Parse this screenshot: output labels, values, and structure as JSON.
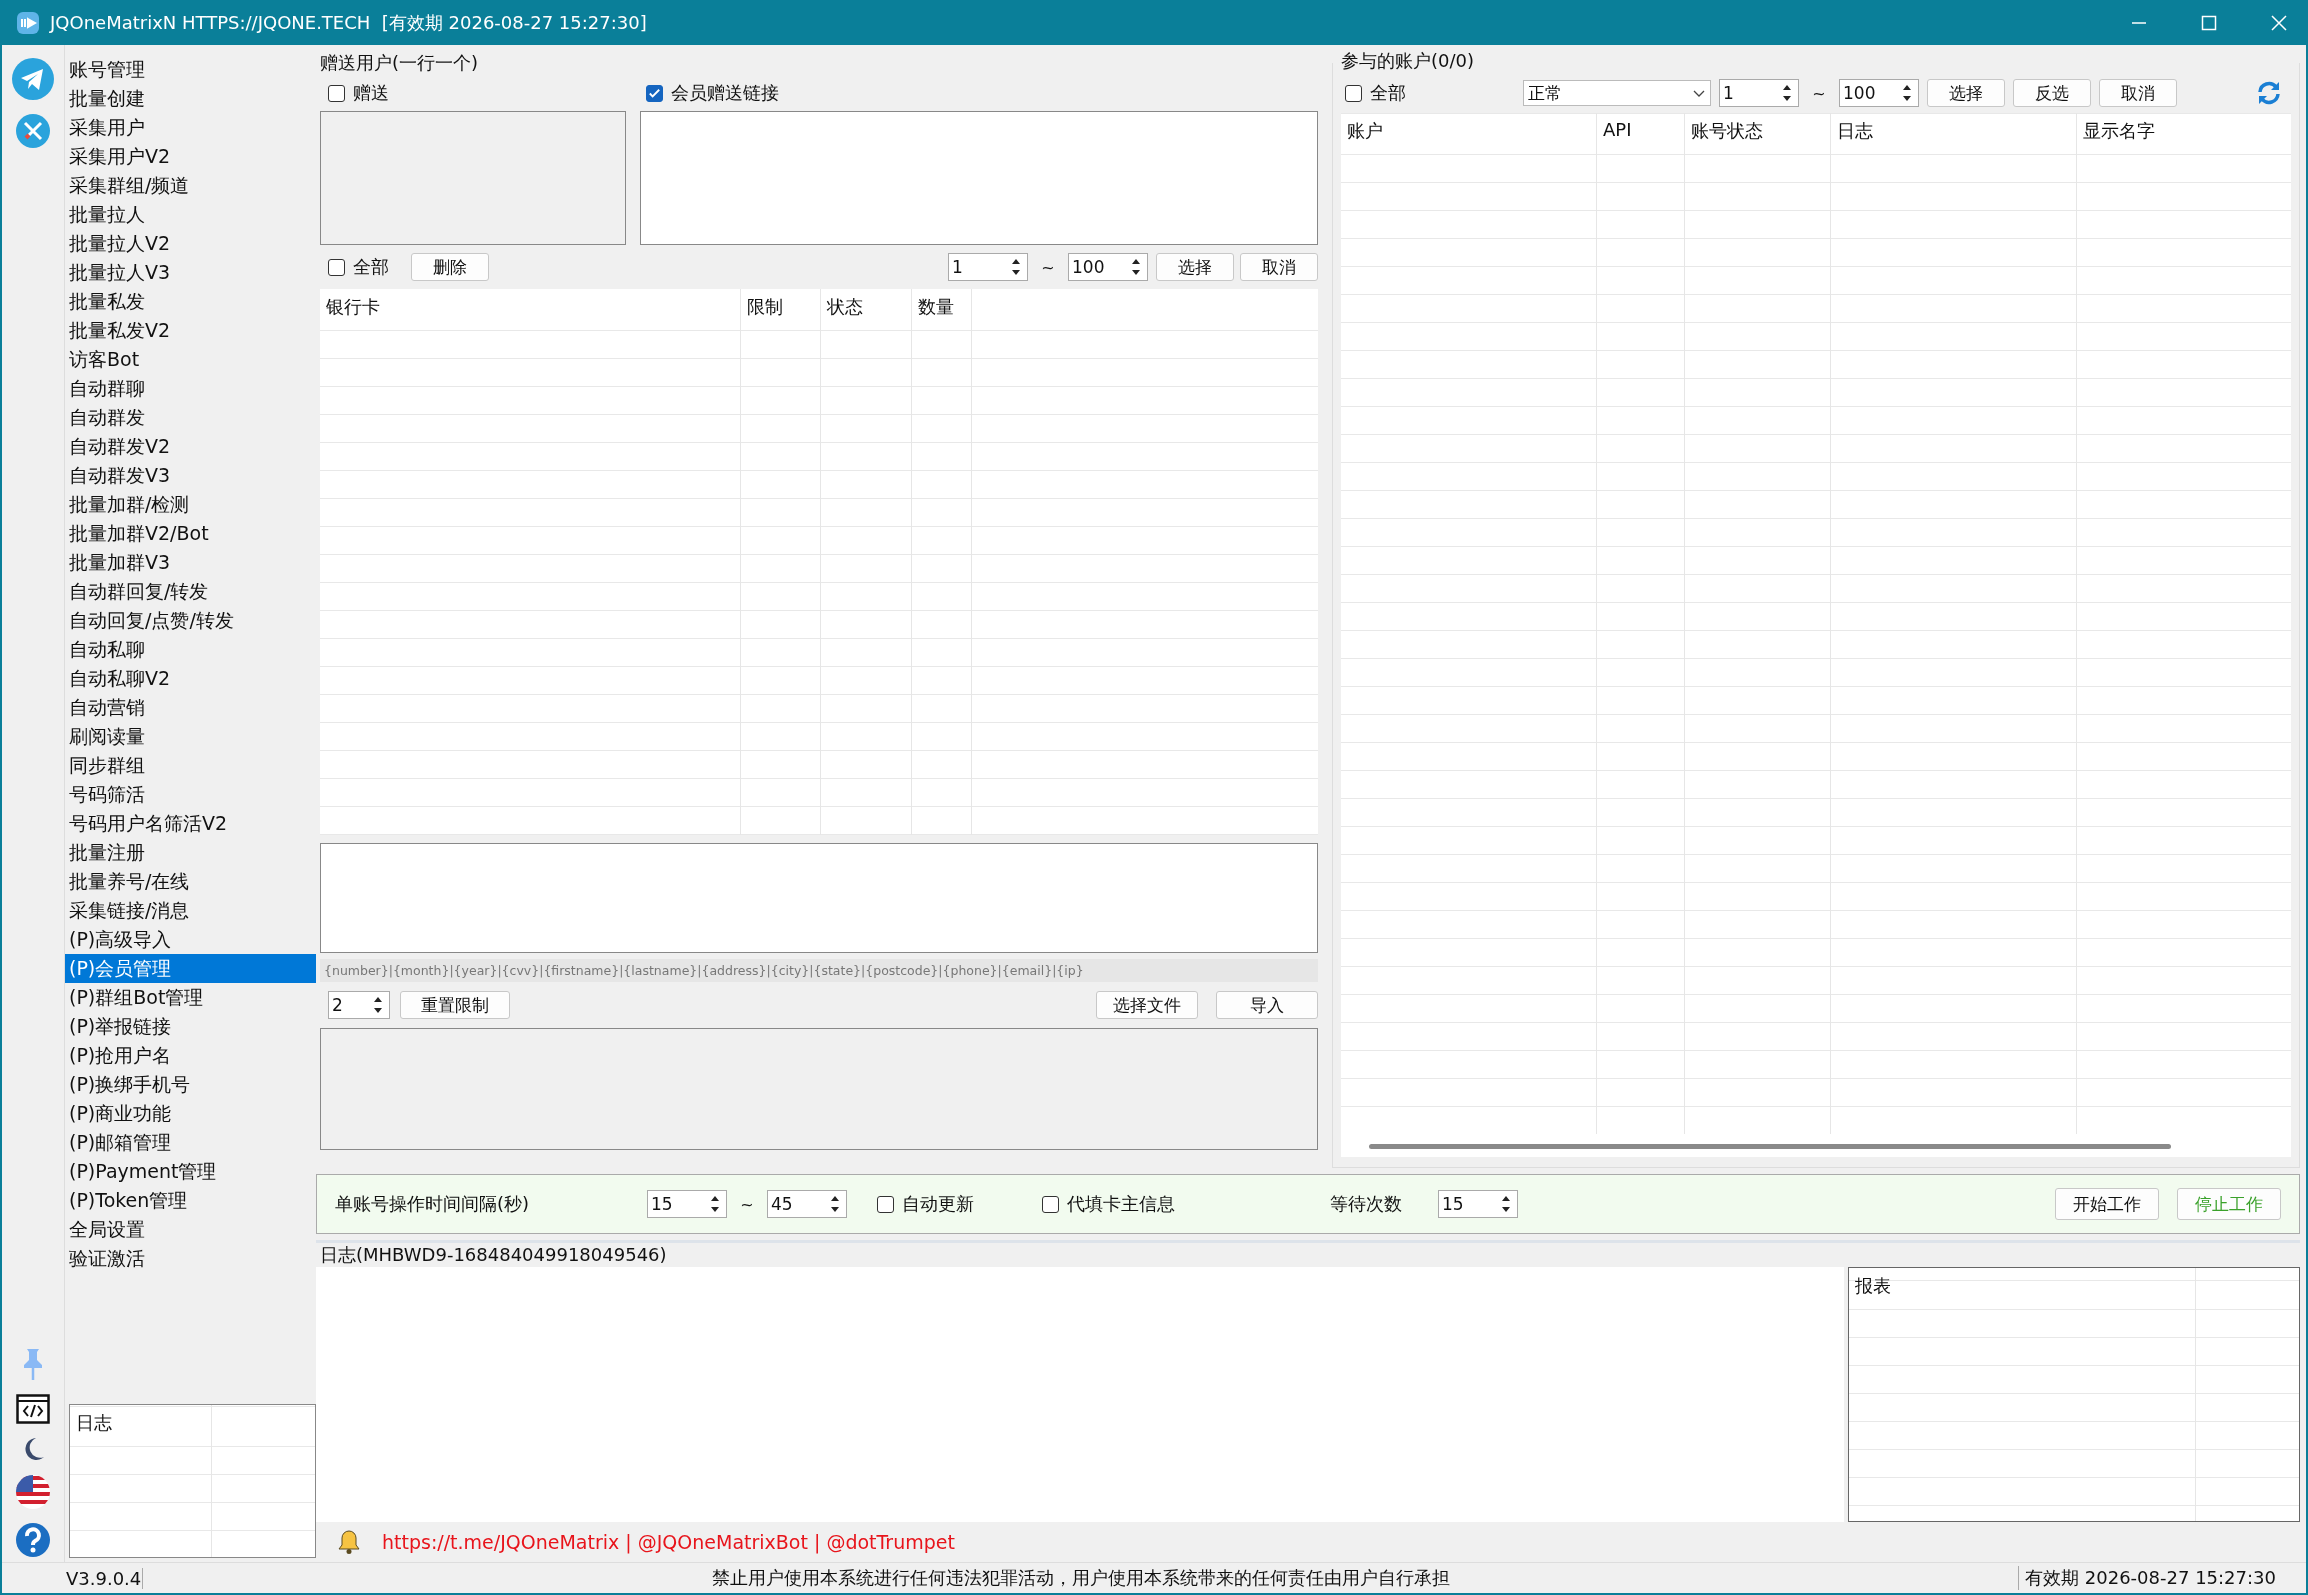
{
  "window": {
    "title": "JQOneMatrixN HTTPS://JQONE.TECH  [有效期 2026-08-27 15:27:30]"
  },
  "sidebar": {
    "items": [
      {
        "label": "账号管理",
        "selected": false
      },
      {
        "label": "批量创建",
        "selected": false
      },
      {
        "label": "采集用户",
        "selected": false
      },
      {
        "label": "采集用户V2",
        "selected": false
      },
      {
        "label": "采集群组/频道",
        "selected": false
      },
      {
        "label": "批量拉人",
        "selected": false
      },
      {
        "label": "批量拉人V2",
        "selected": false
      },
      {
        "label": "批量拉人V3",
        "selected": false
      },
      {
        "label": "批量私发",
        "selected": false
      },
      {
        "label": "批量私发V2",
        "selected": false
      },
      {
        "label": "访客Bot",
        "selected": false
      },
      {
        "label": "自动群聊",
        "selected": false
      },
      {
        "label": "自动群发",
        "selected": false
      },
      {
        "label": "自动群发V2",
        "selected": false
      },
      {
        "label": "自动群发V3",
        "selected": false
      },
      {
        "label": "批量加群/检测",
        "selected": false
      },
      {
        "label": "批量加群V2/Bot",
        "selected": false
      },
      {
        "label": "批量加群V3",
        "selected": false
      },
      {
        "label": "自动群回复/转发",
        "selected": false
      },
      {
        "label": "自动回复/点赞/转发",
        "selected": false
      },
      {
        "label": "自动私聊",
        "selected": false
      },
      {
        "label": "自动私聊V2",
        "selected": false
      },
      {
        "label": "自动营销",
        "selected": false
      },
      {
        "label": "刷阅读量",
        "selected": false
      },
      {
        "label": "同步群组",
        "selected": false
      },
      {
        "label": "号码筛活",
        "selected": false
      },
      {
        "label": "号码用户名筛活V2",
        "selected": false
      },
      {
        "label": "批量注册",
        "selected": false
      },
      {
        "label": "批量养号/在线",
        "selected": false
      },
      {
        "label": "采集链接/消息",
        "selected": false
      },
      {
        "label": "(P)高级导入",
        "selected": false
      },
      {
        "label": "(P)会员管理",
        "selected": true
      },
      {
        "label": "(P)群组Bot管理",
        "selected": false
      },
      {
        "label": "(P)举报链接",
        "selected": false
      },
      {
        "label": "(P)抢用户名",
        "selected": false
      },
      {
        "label": "(P)换绑手机号",
        "selected": false
      },
      {
        "label": "(P)商业功能",
        "selected": false
      },
      {
        "label": "(P)邮箱管理",
        "selected": false
      },
      {
        "label": "(P)Payment管理",
        "selected": false
      },
      {
        "label": "(P)Token管理",
        "selected": false
      },
      {
        "label": "全局设置",
        "selected": false
      },
      {
        "label": "验证激活",
        "selected": false
      }
    ],
    "log_table": {
      "columns": [
        "日志"
      ]
    }
  },
  "gift_panel": {
    "title": "赠送用户(一行一个)",
    "gift": {
      "label": "赠送",
      "checked": false
    },
    "member_link": {
      "label": "会员赠送链接",
      "checked": true
    },
    "select_all": {
      "label": "全部",
      "checked": false
    },
    "delete_button": "删除",
    "range_from": "1",
    "range_sep": "~",
    "range_to": "100",
    "select_button": "选择",
    "cancel_button": "取消",
    "table": {
      "columns": [
        "银行卡",
        "限制",
        "状态",
        "数量"
      ]
    },
    "format_hint": "{number}|{month}|{year}|{cvv}|{firstname}|{lastname}|{address}|{city}|{state}|{postcode}|{phone}|{email}|{ip}",
    "limit_value": "2",
    "reset_limit_button": "重置限制",
    "choose_file_button": "选择文件",
    "import_button": "导入"
  },
  "accounts_panel": {
    "title": "参与的账户(0/0)",
    "select_all": {
      "label": "全部",
      "checked": false
    },
    "status_filter": "正常",
    "range_from": "1",
    "range_sep": "~",
    "range_to": "100",
    "buttons": [
      "选择",
      "反选",
      "取消"
    ],
    "table": {
      "columns": [
        "账户",
        "API",
        "账号状态",
        "日志",
        "显示名字"
      ]
    }
  },
  "work_settings": {
    "interval_label": "单账号操作时间间隔(秒)",
    "interval_from": "15",
    "interval_sep": "~",
    "interval_to": "45",
    "auto_update": {
      "label": "自动更新",
      "checked": false
    },
    "fill_card_holder": {
      "label": "代填卡主信息",
      "checked": false
    },
    "wait_label": "等待次数",
    "wait_value": "15",
    "start_button": "开始工作",
    "stop_button": "停止工作"
  },
  "log": {
    "title": "日志(MHBWD9-168484049918049546)",
    "report_table": {
      "columns": [
        "报表"
      ]
    }
  },
  "links": "https://t.me/JQOneMatrix | @JQOneMatrixBot | @dotTrumpet",
  "status_bar": {
    "version": "V3.9.0.4",
    "notice": "禁止用户使用本系统进行任何违法犯罪活动，用户使用本系统带来的任何责任由用户自行承担",
    "expiry": "有效期 2026-08-27 15:27:30"
  }
}
